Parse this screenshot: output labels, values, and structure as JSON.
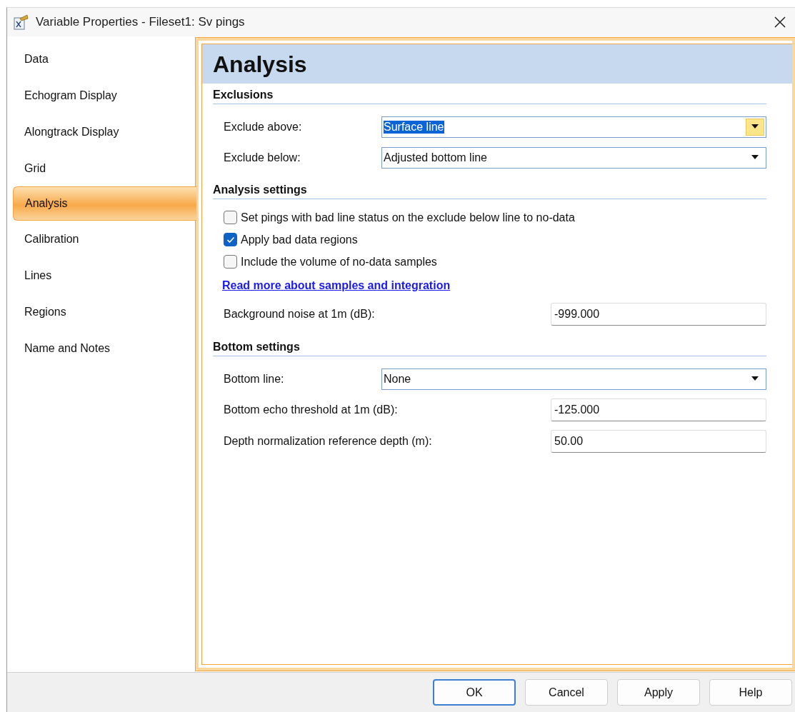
{
  "window": {
    "title": "Variable Properties - Fileset1: Sv pings"
  },
  "sidebar": {
    "items": [
      {
        "label": "Data",
        "selected": false
      },
      {
        "label": "Echogram Display",
        "selected": false
      },
      {
        "label": "Alongtrack Display",
        "selected": false
      },
      {
        "label": "Grid",
        "selected": false
      },
      {
        "label": "Analysis",
        "selected": true
      },
      {
        "label": "Calibration",
        "selected": false
      },
      {
        "label": "Lines",
        "selected": false
      },
      {
        "label": "Regions",
        "selected": false
      },
      {
        "label": "Name and Notes",
        "selected": false
      }
    ]
  },
  "page": {
    "title": "Analysis",
    "sections": [
      {
        "heading": "Exclusions",
        "rows": [
          {
            "kind": "dropdown",
            "label": "Exclude above:",
            "value": "Surface line",
            "focused": true
          },
          {
            "kind": "dropdown",
            "label": "Exclude below:",
            "value": "Adjusted bottom line",
            "focused": false
          }
        ]
      },
      {
        "heading": "Analysis settings",
        "rows": [
          {
            "kind": "checkbox",
            "label": "Set pings with bad line status on the exclude below line to no-data",
            "checked": false
          },
          {
            "kind": "checkbox",
            "label": "Apply bad data regions",
            "checked": true
          },
          {
            "kind": "checkbox",
            "label": "Include the volume of no-data samples",
            "checked": false
          },
          {
            "kind": "link",
            "label": "Read more about samples and integration"
          },
          {
            "kind": "text",
            "label": "Background noise at 1m (dB):",
            "value": "-999.000"
          }
        ]
      },
      {
        "heading": "Bottom settings",
        "rows": [
          {
            "kind": "dropdown",
            "label": "Bottom line:",
            "value": "None",
            "focused": false
          },
          {
            "kind": "text",
            "label": "Bottom echo threshold at 1m (dB):",
            "value": "-125.000"
          },
          {
            "kind": "text",
            "label": "Depth normalization reference depth (m):",
            "value": "50.00"
          }
        ]
      }
    ]
  },
  "buttons": [
    {
      "label": "OK",
      "default": true
    },
    {
      "label": "Cancel",
      "default": false
    },
    {
      "label": "Apply",
      "default": false
    },
    {
      "label": "Help",
      "default": false
    }
  ]
}
